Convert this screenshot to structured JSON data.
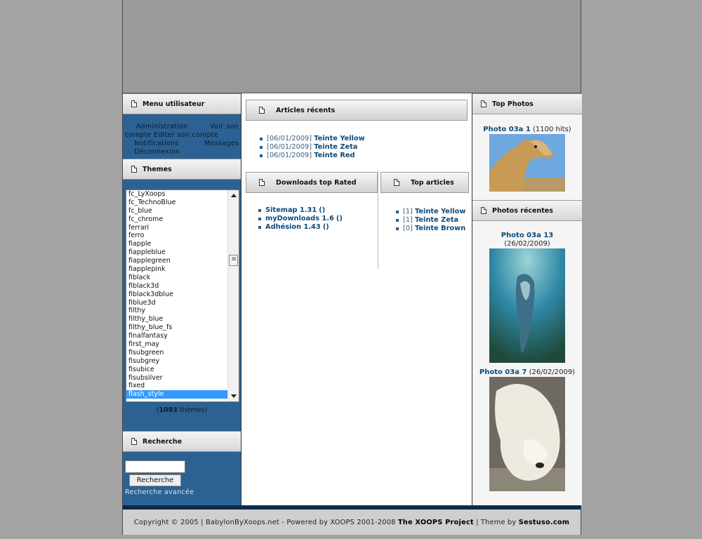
{
  "user_menu": {
    "title": "Menu utilisateur",
    "items": [
      "Administration",
      "Voir son compte",
      "Editer son compte",
      "Notifications",
      "Messages",
      "Déconnexion"
    ]
  },
  "themes": {
    "title": "Themes",
    "list": [
      "fc_LyXoops",
      "fc_TechnoBlue",
      "fc_blue",
      "fc_chrome",
      "ferrari",
      "ferro",
      "fiapple",
      "fiappleblue",
      "fiapplegreen",
      "fiapplepink",
      "fiblack",
      "fiblack3d",
      "fiblack3dblue",
      "fiblue3d",
      "filthy",
      "filthy_blue",
      "filthy_blue_fs",
      "finalfantasy",
      "first_may",
      "fisubgreen",
      "fisubgrey",
      "fisubice",
      "fisubsilver",
      "fixed",
      "flash_style"
    ],
    "selected": "flash_style",
    "count_number": "1093",
    "count_label": "thèmes"
  },
  "search": {
    "title": "Recherche",
    "button": "Recherche",
    "advanced": "Recherche avancée",
    "value": ""
  },
  "recent_articles": {
    "title": "Articles récents",
    "items": [
      {
        "date": "[06/01/2009]",
        "title": "Teinte Yellow"
      },
      {
        "date": "[06/01/2009]",
        "title": "Teinte Zeta"
      },
      {
        "date": "[06/01/2009]",
        "title": "Teinte Red"
      }
    ]
  },
  "downloads": {
    "title": "Downloads top Rated",
    "items": [
      {
        "name": "Sitemap 1.31",
        "suffix": "()"
      },
      {
        "name": "myDownloads 1.6",
        "suffix": "()"
      },
      {
        "name": "Adhésion 1.43",
        "suffix": "()"
      }
    ]
  },
  "top_articles": {
    "title": "Top articles",
    "items": [
      {
        "rank": "[1]",
        "title": "Teinte Yellow"
      },
      {
        "rank": "[1]",
        "title": "Teinte Zeta"
      },
      {
        "rank": "[0]",
        "title": "Teinte Brown"
      }
    ]
  },
  "top_photos": {
    "title": "Top Photos",
    "photo": {
      "title": "Photo 03a 1",
      "meta": "(1100 hits)"
    }
  },
  "recent_photos": {
    "title": "Photos récentes",
    "photos": [
      {
        "title": "Photo 03a 13",
        "meta": "(26/02/2009)"
      },
      {
        "title": "Photo 03a 7",
        "meta": "(26/02/2009)"
      }
    ]
  },
  "footer": {
    "copyright": "Copyright © 2005 | BabylonByXoops.net - Powered by XOOPS 2001-2008",
    "project": "The XOOPS Project",
    "theme_by": "| Theme by",
    "author": "Sestuso.com"
  },
  "colors": {
    "left_bg": "#2c6293",
    "link": "#0d4a7a",
    "selected": "#3399ff",
    "footer_bar": "#0e2a4a"
  }
}
